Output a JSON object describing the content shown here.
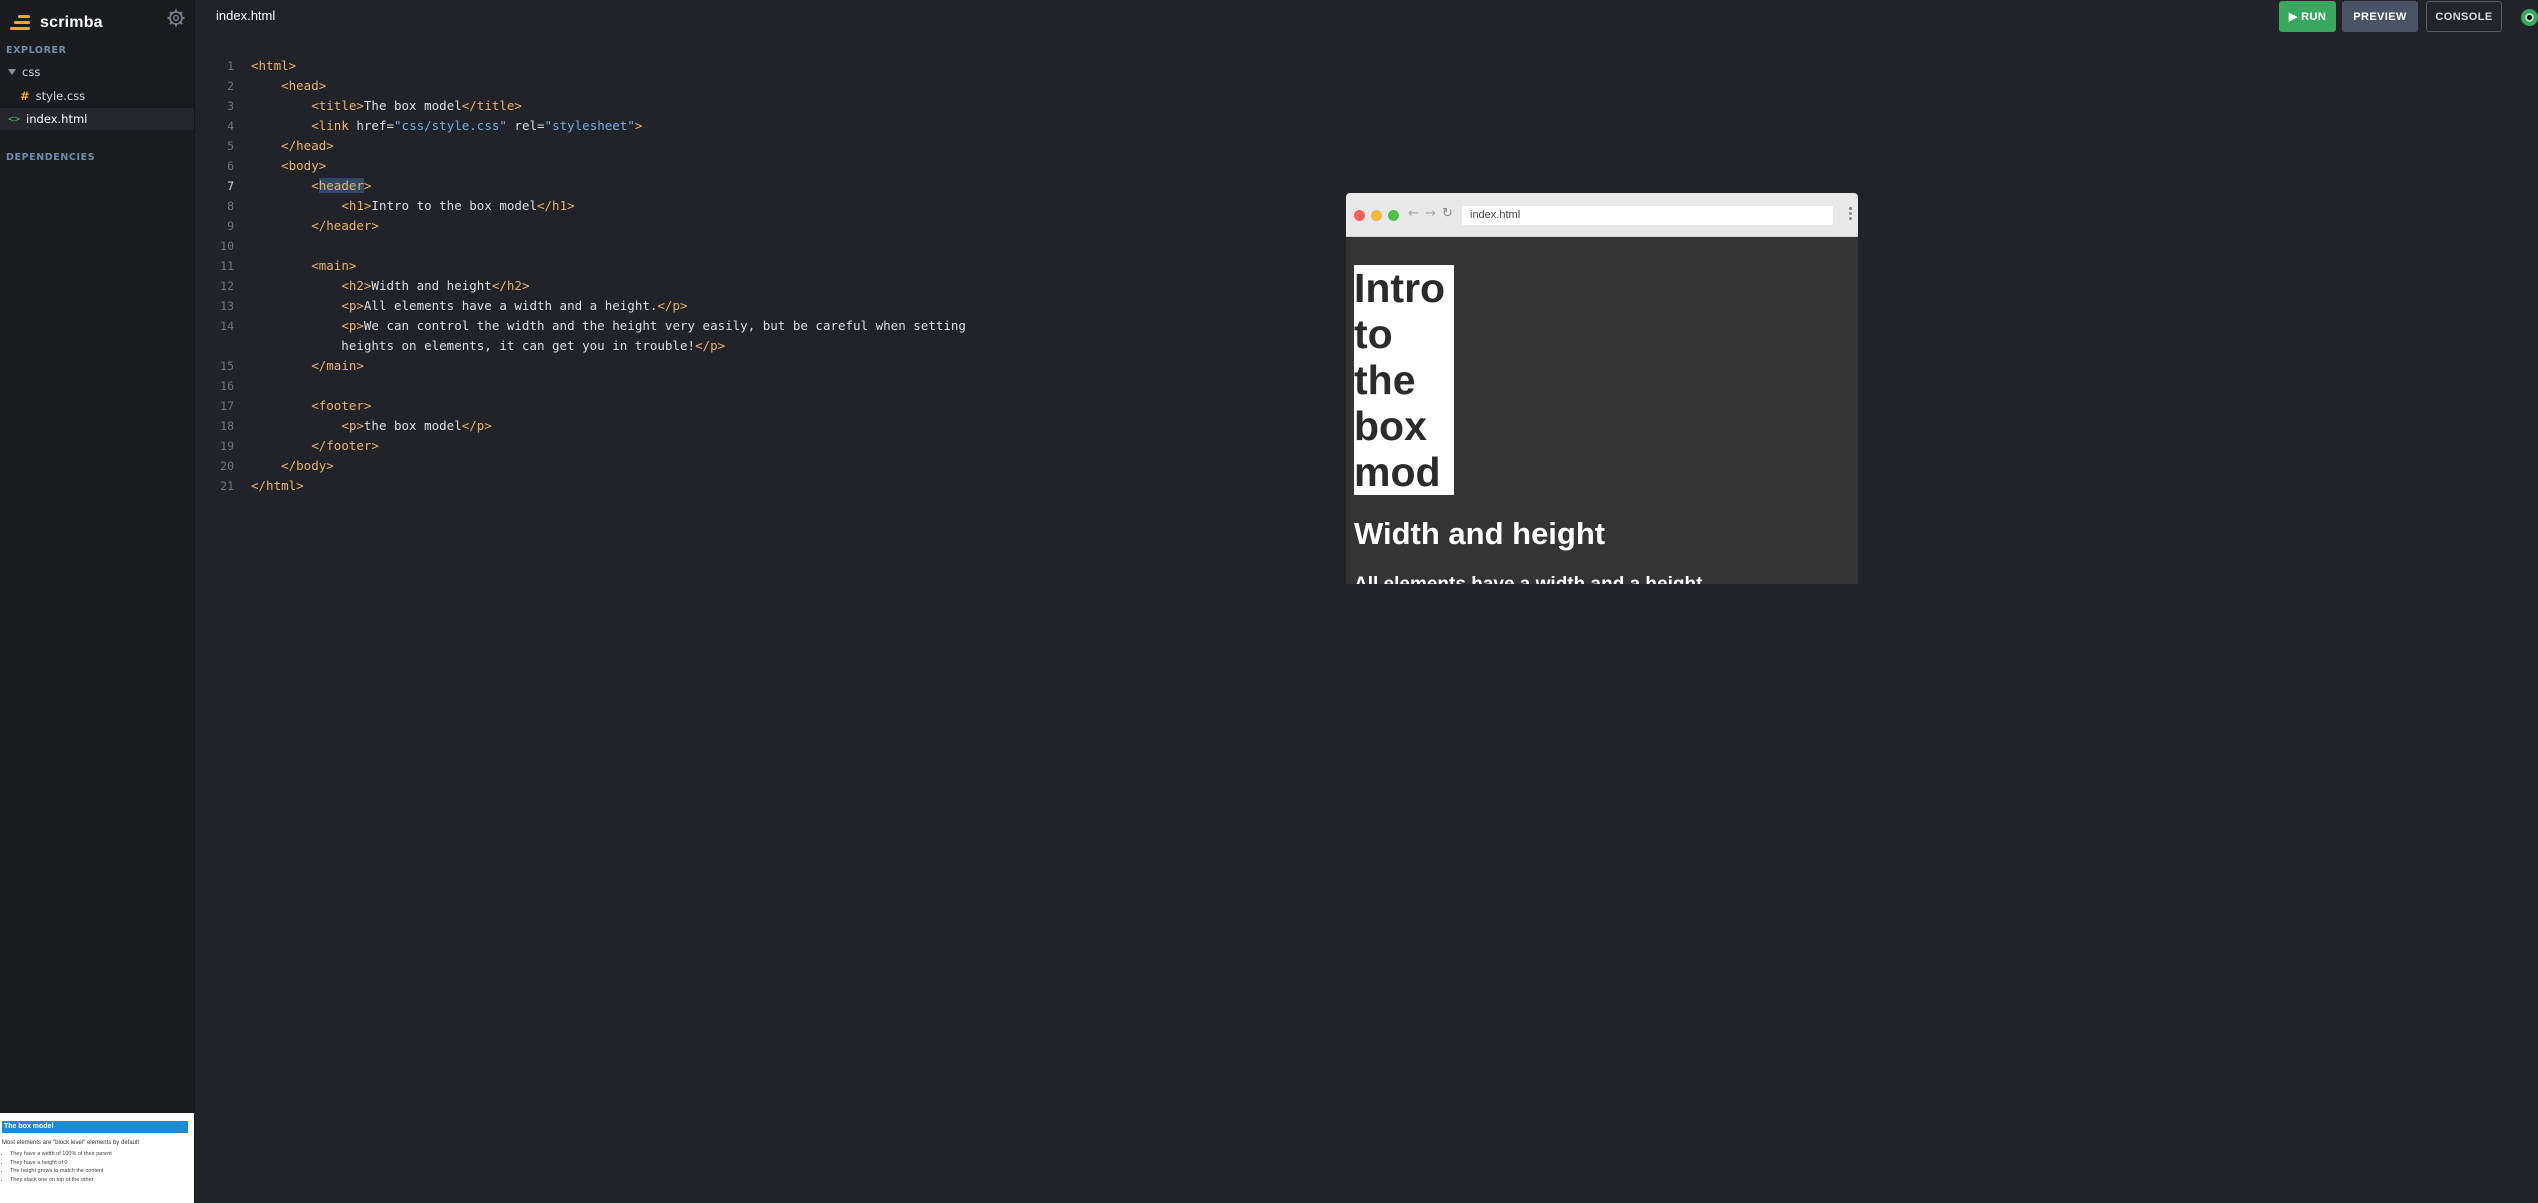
{
  "app": {
    "name": "scrimba",
    "current_file": "index.html"
  },
  "sidebar": {
    "explorer_label": "EXPLORER",
    "folder": "css",
    "files": [
      {
        "name": "style.css",
        "icon": "hash-icon"
      },
      {
        "name": "index.html",
        "icon": "code-icon",
        "active": true
      }
    ],
    "dependencies_label": "DEPENDENCIES"
  },
  "toolbar": {
    "run_label": "▶ RUN",
    "preview_label": "PREVIEW",
    "console_label": "CONSOLE"
  },
  "colors": {
    "run": "#3aa75f",
    "preview_btn": "#4a5365",
    "tag": "#e5b56a",
    "string": "#6ab0de",
    "accent": "#f5a623"
  },
  "editor": {
    "current_line": 7,
    "lines": [
      {
        "n": "1",
        "tokens": [
          [
            "t",
            "<html>"
          ]
        ]
      },
      {
        "n": "2",
        "tokens": [
          [
            "x",
            "    "
          ],
          [
            "t",
            "<head>"
          ]
        ]
      },
      {
        "n": "3",
        "tokens": [
          [
            "x",
            "        "
          ],
          [
            "t",
            "<title>"
          ],
          [
            "x",
            "The box model"
          ],
          [
            "t",
            "</title>"
          ]
        ]
      },
      {
        "n": "4",
        "tokens": [
          [
            "x",
            "        "
          ],
          [
            "t",
            "<link"
          ],
          [
            "x",
            " href="
          ],
          [
            "s",
            "\"css/style.css\""
          ],
          [
            "x",
            " rel="
          ],
          [
            "s",
            "\"stylesheet\""
          ],
          [
            "t",
            ">"
          ]
        ]
      },
      {
        "n": "5",
        "tokens": [
          [
            "x",
            "    "
          ],
          [
            "t",
            "</head>"
          ]
        ]
      },
      {
        "n": "6",
        "tokens": [
          [
            "x",
            "    "
          ],
          [
            "t",
            "<body>"
          ]
        ]
      },
      {
        "n": "7",
        "tokens": [
          [
            "x",
            "        "
          ],
          [
            "t",
            "<"
          ],
          [
            "h",
            "header"
          ],
          [
            "t",
            ">"
          ]
        ]
      },
      {
        "n": "8",
        "tokens": [
          [
            "x",
            "            "
          ],
          [
            "t",
            "<h1>"
          ],
          [
            "x",
            "Intro to the box model"
          ],
          [
            "t",
            "</h1>"
          ]
        ]
      },
      {
        "n": "9",
        "tokens": [
          [
            "x",
            "        "
          ],
          [
            "t",
            "</header>"
          ]
        ]
      },
      {
        "n": "10",
        "tokens": []
      },
      {
        "n": "11",
        "tokens": [
          [
            "x",
            "        "
          ],
          [
            "t",
            "<main>"
          ]
        ]
      },
      {
        "n": "12",
        "tokens": [
          [
            "x",
            "            "
          ],
          [
            "t",
            "<h2>"
          ],
          [
            "x",
            "Width and height"
          ],
          [
            "t",
            "</h2>"
          ]
        ]
      },
      {
        "n": "13",
        "tokens": [
          [
            "x",
            "            "
          ],
          [
            "t",
            "<p>"
          ],
          [
            "x",
            "All elements have a width and a height."
          ],
          [
            "t",
            "</p>"
          ]
        ]
      },
      {
        "n": "14",
        "tokens": [
          [
            "x",
            "            "
          ],
          [
            "t",
            "<p>"
          ],
          [
            "x",
            "We can control the width and the height very easily, but be careful when setting"
          ]
        ]
      },
      {
        "n": "",
        "tokens": [
          [
            "x",
            "            heights on elements, it can get you in trouble!"
          ],
          [
            "t",
            "</p>"
          ]
        ]
      },
      {
        "n": "15",
        "tokens": [
          [
            "x",
            "        "
          ],
          [
            "t",
            "</main>"
          ]
        ]
      },
      {
        "n": "16",
        "tokens": []
      },
      {
        "n": "17",
        "tokens": [
          [
            "x",
            "        "
          ],
          [
            "t",
            "<footer>"
          ]
        ]
      },
      {
        "n": "18",
        "tokens": [
          [
            "x",
            "            "
          ],
          [
            "t",
            "<p>"
          ],
          [
            "x",
            "the box model"
          ],
          [
            "t",
            "</p>"
          ]
        ]
      },
      {
        "n": "19",
        "tokens": [
          [
            "x",
            "        "
          ],
          [
            "t",
            "</footer>"
          ]
        ]
      },
      {
        "n": "20",
        "tokens": [
          [
            "x",
            "    "
          ],
          [
            "t",
            "</body>"
          ]
        ]
      },
      {
        "n": "21",
        "tokens": [
          [
            "t",
            "</html>"
          ]
        ]
      }
    ]
  },
  "preview": {
    "url": "index.html",
    "h1": "Intro to the box model",
    "h2": "Width and height",
    "p": "All elements have a width and a height."
  },
  "slide": {
    "title": "The box model",
    "text": "Most elements are \"block level\" elements by default",
    "bullets": [
      "They have a width of 100% of their parent",
      "They have a height of 0",
      "The height grows to match the content",
      "They stack one on top of the other"
    ]
  }
}
